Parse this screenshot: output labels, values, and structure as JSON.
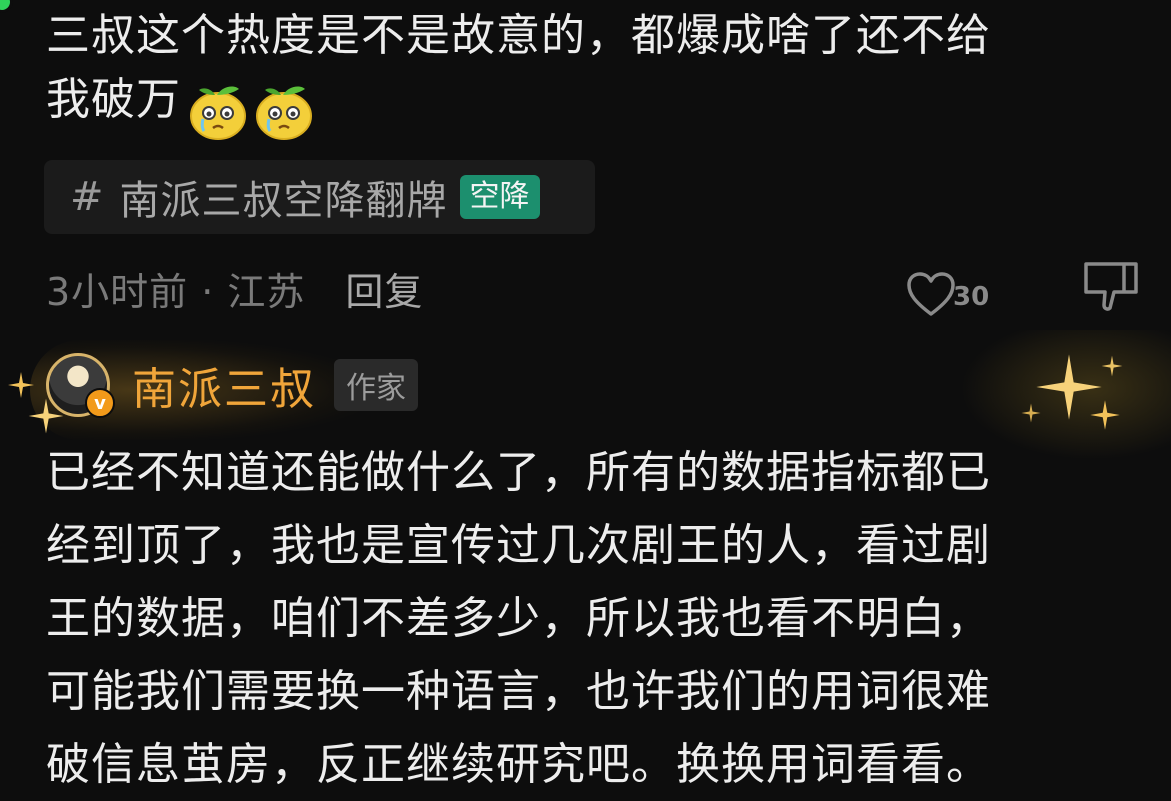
{
  "comment": {
    "text_line1": "三叔这个热度是不是故意的，都爆成啥了还不给",
    "text_line2": "我破万",
    "emojis": [
      "lemon-crying-emoji",
      "lemon-crying-emoji"
    ],
    "topic": {
      "hash": "#",
      "label": "南派三叔空降翻牌",
      "badge": "空降"
    },
    "meta": {
      "time_location": "3小时前 · 江苏",
      "reply_label": "回复"
    },
    "likes": "30",
    "icons": {
      "like": "heart-icon",
      "dislike": "thumbs-down-icon"
    }
  },
  "reply": {
    "author_name": "南派三叔",
    "author_tag": "作家",
    "verified_badge": "v",
    "lines": [
      "已经不知道还能做什么了，所有的数据指标都已",
      "经到顶了，我也是宣传过几次剧王的人，看过剧",
      "王的数据，咱们不差多少，所以我也看不明白，",
      "可能我们需要换一种语言，也许我们的用词很难",
      "破信息茧房，反正继续研究吧。换换用词看看。"
    ]
  },
  "colors": {
    "background": "#0d0d0d",
    "text": "#ededed",
    "author": "#f0a53a",
    "badge": "#1c8f6e",
    "online": "#2fd35a"
  }
}
